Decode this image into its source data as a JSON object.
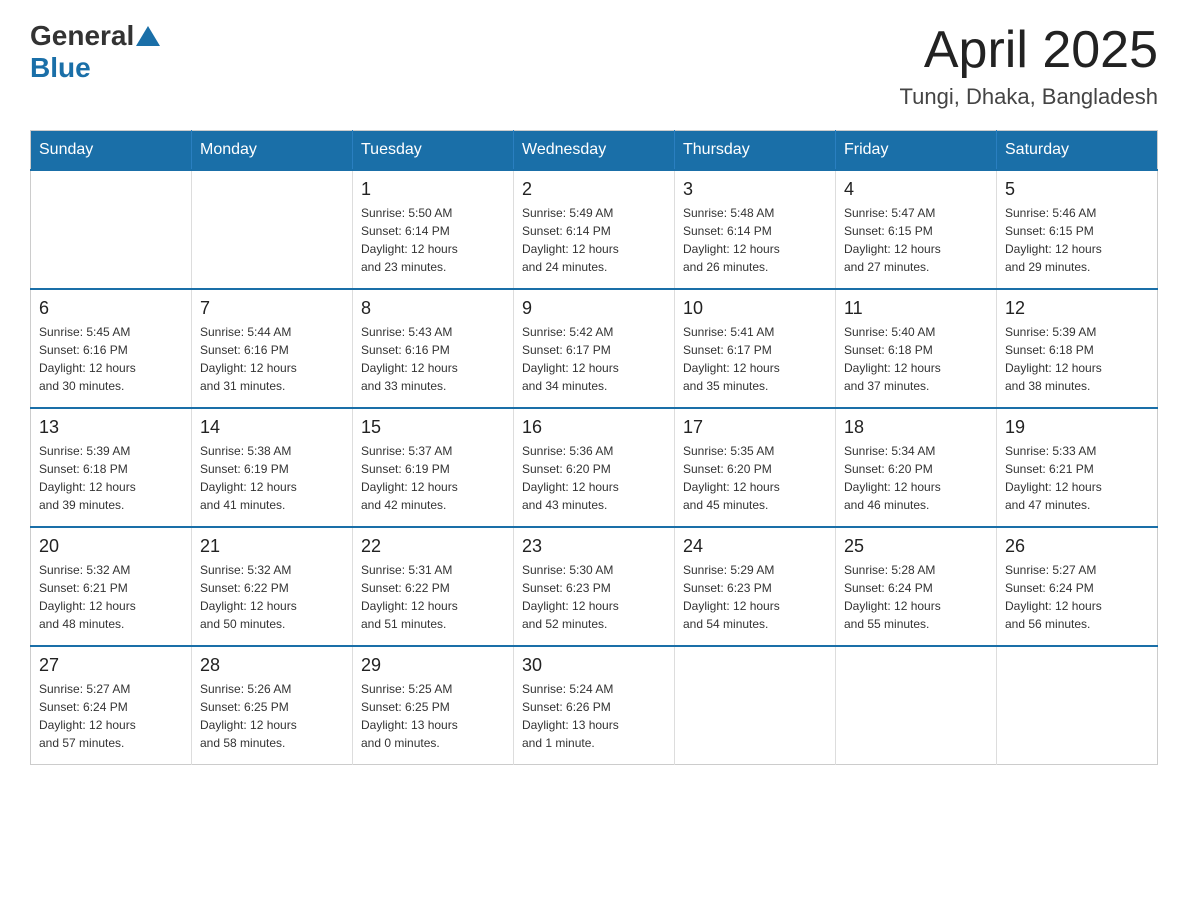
{
  "header": {
    "logo": {
      "general": "General",
      "blue": "Blue"
    },
    "title": "April 2025",
    "subtitle": "Tungi, Dhaka, Bangladesh"
  },
  "weekdays": [
    "Sunday",
    "Monday",
    "Tuesday",
    "Wednesday",
    "Thursday",
    "Friday",
    "Saturday"
  ],
  "weeks": [
    [
      {
        "day": "",
        "info": ""
      },
      {
        "day": "",
        "info": ""
      },
      {
        "day": "1",
        "info": "Sunrise: 5:50 AM\nSunset: 6:14 PM\nDaylight: 12 hours\nand 23 minutes."
      },
      {
        "day": "2",
        "info": "Sunrise: 5:49 AM\nSunset: 6:14 PM\nDaylight: 12 hours\nand 24 minutes."
      },
      {
        "day": "3",
        "info": "Sunrise: 5:48 AM\nSunset: 6:14 PM\nDaylight: 12 hours\nand 26 minutes."
      },
      {
        "day": "4",
        "info": "Sunrise: 5:47 AM\nSunset: 6:15 PM\nDaylight: 12 hours\nand 27 minutes."
      },
      {
        "day": "5",
        "info": "Sunrise: 5:46 AM\nSunset: 6:15 PM\nDaylight: 12 hours\nand 29 minutes."
      }
    ],
    [
      {
        "day": "6",
        "info": "Sunrise: 5:45 AM\nSunset: 6:16 PM\nDaylight: 12 hours\nand 30 minutes."
      },
      {
        "day": "7",
        "info": "Sunrise: 5:44 AM\nSunset: 6:16 PM\nDaylight: 12 hours\nand 31 minutes."
      },
      {
        "day": "8",
        "info": "Sunrise: 5:43 AM\nSunset: 6:16 PM\nDaylight: 12 hours\nand 33 minutes."
      },
      {
        "day": "9",
        "info": "Sunrise: 5:42 AM\nSunset: 6:17 PM\nDaylight: 12 hours\nand 34 minutes."
      },
      {
        "day": "10",
        "info": "Sunrise: 5:41 AM\nSunset: 6:17 PM\nDaylight: 12 hours\nand 35 minutes."
      },
      {
        "day": "11",
        "info": "Sunrise: 5:40 AM\nSunset: 6:18 PM\nDaylight: 12 hours\nand 37 minutes."
      },
      {
        "day": "12",
        "info": "Sunrise: 5:39 AM\nSunset: 6:18 PM\nDaylight: 12 hours\nand 38 minutes."
      }
    ],
    [
      {
        "day": "13",
        "info": "Sunrise: 5:39 AM\nSunset: 6:18 PM\nDaylight: 12 hours\nand 39 minutes."
      },
      {
        "day": "14",
        "info": "Sunrise: 5:38 AM\nSunset: 6:19 PM\nDaylight: 12 hours\nand 41 minutes."
      },
      {
        "day": "15",
        "info": "Sunrise: 5:37 AM\nSunset: 6:19 PM\nDaylight: 12 hours\nand 42 minutes."
      },
      {
        "day": "16",
        "info": "Sunrise: 5:36 AM\nSunset: 6:20 PM\nDaylight: 12 hours\nand 43 minutes."
      },
      {
        "day": "17",
        "info": "Sunrise: 5:35 AM\nSunset: 6:20 PM\nDaylight: 12 hours\nand 45 minutes."
      },
      {
        "day": "18",
        "info": "Sunrise: 5:34 AM\nSunset: 6:20 PM\nDaylight: 12 hours\nand 46 minutes."
      },
      {
        "day": "19",
        "info": "Sunrise: 5:33 AM\nSunset: 6:21 PM\nDaylight: 12 hours\nand 47 minutes."
      }
    ],
    [
      {
        "day": "20",
        "info": "Sunrise: 5:32 AM\nSunset: 6:21 PM\nDaylight: 12 hours\nand 48 minutes."
      },
      {
        "day": "21",
        "info": "Sunrise: 5:32 AM\nSunset: 6:22 PM\nDaylight: 12 hours\nand 50 minutes."
      },
      {
        "day": "22",
        "info": "Sunrise: 5:31 AM\nSunset: 6:22 PM\nDaylight: 12 hours\nand 51 minutes."
      },
      {
        "day": "23",
        "info": "Sunrise: 5:30 AM\nSunset: 6:23 PM\nDaylight: 12 hours\nand 52 minutes."
      },
      {
        "day": "24",
        "info": "Sunrise: 5:29 AM\nSunset: 6:23 PM\nDaylight: 12 hours\nand 54 minutes."
      },
      {
        "day": "25",
        "info": "Sunrise: 5:28 AM\nSunset: 6:24 PM\nDaylight: 12 hours\nand 55 minutes."
      },
      {
        "day": "26",
        "info": "Sunrise: 5:27 AM\nSunset: 6:24 PM\nDaylight: 12 hours\nand 56 minutes."
      }
    ],
    [
      {
        "day": "27",
        "info": "Sunrise: 5:27 AM\nSunset: 6:24 PM\nDaylight: 12 hours\nand 57 minutes."
      },
      {
        "day": "28",
        "info": "Sunrise: 5:26 AM\nSunset: 6:25 PM\nDaylight: 12 hours\nand 58 minutes."
      },
      {
        "day": "29",
        "info": "Sunrise: 5:25 AM\nSunset: 6:25 PM\nDaylight: 13 hours\nand 0 minutes."
      },
      {
        "day": "30",
        "info": "Sunrise: 5:24 AM\nSunset: 6:26 PM\nDaylight: 13 hours\nand 1 minute."
      },
      {
        "day": "",
        "info": ""
      },
      {
        "day": "",
        "info": ""
      },
      {
        "day": "",
        "info": ""
      }
    ]
  ]
}
